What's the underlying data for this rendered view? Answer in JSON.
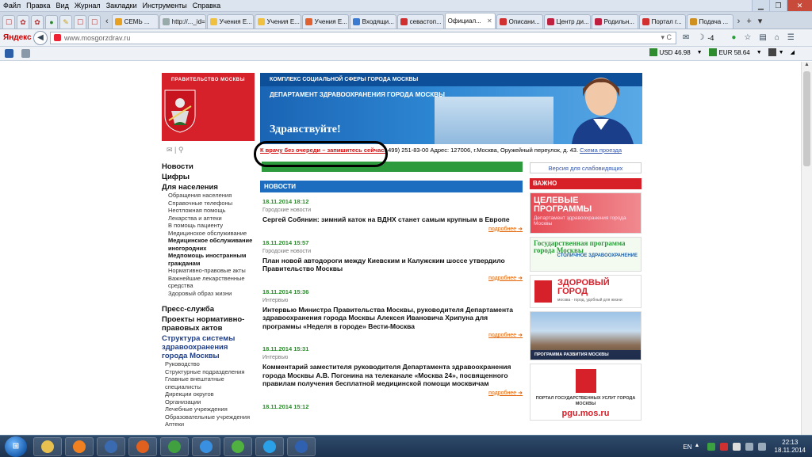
{
  "menubar": {
    "items": [
      "Файл",
      "Правка",
      "Вид",
      "Журнал",
      "Закладки",
      "Инструменты",
      "Справка"
    ]
  },
  "tabs": [
    {
      "label": "СЕМЬ ...",
      "color": "#e8a020"
    },
    {
      "label": "http://..._id=58",
      "color": "#9aa"
    },
    {
      "label": "Учения Е...",
      "color": "#f0c040"
    },
    {
      "label": "Учения Е...",
      "color": "#f0c040"
    },
    {
      "label": "Учения Е...",
      "color": "#e06030"
    },
    {
      "label": "Входящи...",
      "color": "#3a7ad0"
    },
    {
      "label": "севастоп...",
      "color": "#d03030"
    },
    {
      "label": "Официал...",
      "color": "#ffffff",
      "active": true
    },
    {
      "label": "Описани...",
      "color": "#d03030"
    },
    {
      "label": "Центр ди...",
      "color": "#c02040"
    },
    {
      "label": "Родильн...",
      "color": "#c02040"
    },
    {
      "label": "Портал г...",
      "color": "#d03030"
    },
    {
      "label": "Подача ...",
      "color": "#d09020"
    }
  ],
  "navbar": {
    "brand": "Яндекс",
    "url": "www.mosgorzdrav.ru",
    "badge": "-4"
  },
  "rates": {
    "usd": "USD 46.98",
    "eur": "EUR 58.64"
  },
  "site": {
    "gov_label": "ПРАВИТЕЛЬСТВО МОСКВЫ",
    "banner_top": "КОМПЛЕКС СОЦИАЛЬНОЙ СФЕРЫ ГОРОДА МОСКВЫ",
    "banner_dept": "ДЕПАРТАМЕНТ ЗДРАВООХРАНЕНИЯ ГОРОДА МОСКВЫ",
    "banner_hello": "Здравствуйте!",
    "queue_link": "К врачу без очереди – запишитесь сейчас!",
    "contact_text": "499) 251-83-00 Адрес: 127006, г.Москва, Оружейный переулок, д. 43.",
    "route_link": "Схема проезда",
    "vision_link": "Версия для слабовидящих",
    "important": "ВАЖНО",
    "news_header": "НОВОСТИ"
  },
  "leftnav": {
    "top": [
      "Новости",
      "Цифры"
    ],
    "population_title": "Для населения",
    "population": [
      {
        "label": "Обращения населения"
      },
      {
        "label": "Справочные телефоны"
      },
      {
        "label": "Неотложная помощь"
      },
      {
        "label": "Лекарства и аптеки"
      },
      {
        "label": "В помощь пациенту"
      },
      {
        "label": "Медицинское обслуживание"
      },
      {
        "label": "Медицинское обслуживание иногородних",
        "bold": true
      },
      {
        "label": "Медпомощь иностранным гражданам",
        "bold": true
      },
      {
        "label": "Нормативно-правовые акты"
      },
      {
        "label": "Важнейшие лекарственные средства"
      },
      {
        "label": "Здоровый образ жизни"
      }
    ],
    "press": "Пресс-служба",
    "projects": "Проекты нормативно-правовых актов",
    "structure_title": "Структура системы здравоохранения города Москвы",
    "structure": [
      "Руководство",
      "Структурные подразделения",
      "Главные внештатные специалисты",
      "Дирекции округов",
      "Организации",
      "Лечебные учреждения",
      "Образовательные учреждения",
      "Аптеки"
    ]
  },
  "news": [
    {
      "date": "18.11.2014 18:12",
      "category": "Городские новости",
      "title": "Сергей Собянин: зимний каток на ВДНХ станет самым крупным в Европе",
      "more": "подробнее"
    },
    {
      "date": "18.11.2014 15:57",
      "category": "Городские новости",
      "title": "План новой автодороги между Киевским и Калужским шоссе утвердило Правительство Москвы",
      "more": "подробнее"
    },
    {
      "date": "18.11.2014 15:36",
      "category": "Интервью",
      "title": "Интервью Министра Правительства Москвы, руководителя Департамента здравоохранения города Москвы Алексея Ивановича Хрипуна для программы «Неделя в городе» Вести-Москва",
      "more": "подробнее"
    },
    {
      "date": "18.11.2014 15:31",
      "category": "Интервью",
      "title": "Комментарий заместителя руководителя Департамента здравоохранения города Москвы А.В. Погонина на телеканале «Москва 24», посвященного правилам получения бесплатной медицинской помощи москвичам",
      "more": "подробнее"
    },
    {
      "date": "18.11.2014 15:12",
      "category": "",
      "title": "",
      "more": ""
    }
  ],
  "promos": {
    "p1_title": "ЦЕЛЕВЫЕ ПРОГРАММЫ",
    "p1_sub": "Департамент здравоохранения города Москвы",
    "p2_title": "Государственная программа города Москвы",
    "p2_sub": "СТОЛИЧНОЕ ЗДРАВООХРАНЕНИЕ",
    "p3_title": "ЗДОРОВЫЙ ГОРОД",
    "p3_sub": "москва - город, удобный для жизни",
    "p4_title": "ПРОГРАММА РАЗВИТИЯ МОСКВЫ",
    "p5_title": "ПОРТАЛ ГОСУДАРСТВЕННЫХ УСЛУГ ГОРОДА МОСКВЫ",
    "p5_link": "pgu.mos.ru"
  },
  "taskbar": {
    "apps": [
      {
        "name": "explorer",
        "color": "#e8c050"
      },
      {
        "name": "media-player",
        "color": "#f08020"
      },
      {
        "name": "floppy",
        "color": "#3a6ab0"
      },
      {
        "name": "firefox",
        "color": "#e06020"
      },
      {
        "name": "chrome",
        "color": "#40a040"
      },
      {
        "name": "ie",
        "color": "#3a90e0"
      },
      {
        "name": "utorrent",
        "color": "#50b040"
      },
      {
        "name": "skype",
        "color": "#2aa0e8"
      },
      {
        "name": "word",
        "color": "#3060b0"
      }
    ],
    "lang": "EN",
    "time": "22:13",
    "date": "18.11.2014"
  }
}
